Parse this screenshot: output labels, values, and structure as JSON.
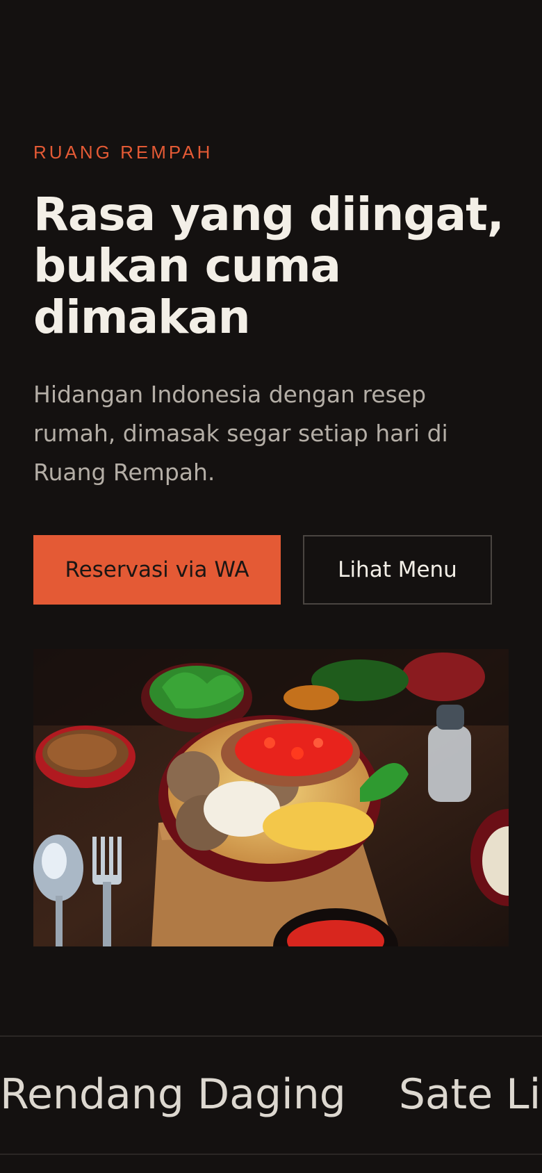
{
  "hero": {
    "eyebrow": "RUANG REMPAH",
    "headline": "Rasa yang diingat, bukan cuma dimakan",
    "lead": "Hidangan Indonesia dengan resep rumah, dimasak segar setiap hari di Ruang Rempah.",
    "primary_button": "Reservasi via WA",
    "secondary_button": "Lihat Menu"
  },
  "colors": {
    "background": "#141110",
    "accent": "#e45a35",
    "headline": "#f3efe7",
    "body_text": "#b4aea6"
  },
  "marquee": {
    "items": [
      "Rendang Daging",
      "Sate Lilit"
    ]
  }
}
